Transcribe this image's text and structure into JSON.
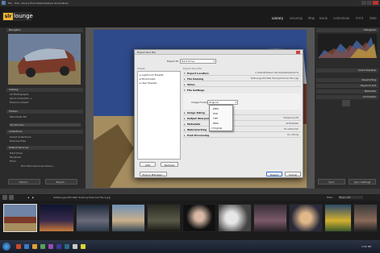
{
  "titlebar": {
    "menu": [
      "File",
      "Edit",
      "Library",
      "Photo",
      "Metadata",
      "View",
      "Window",
      "Help"
    ]
  },
  "brand": {
    "badge": "slr",
    "name": "lounge"
  },
  "modules": [
    "Library",
    "Develop",
    "Map",
    "Book",
    "Slideshow",
    "Print",
    "Web"
  ],
  "left_panel": {
    "navigator": "Navigator",
    "catalog": "Catalog",
    "catalog_items": [
      "All Photographs",
      "Quick Collection +",
      "Previous Import"
    ],
    "folders": "Folders",
    "folder_items": [
      "Macintosh HD",
      "My Pictures"
    ],
    "collections": "Collections",
    "collection_items": [
      "Smart Collections",
      "Exercise Files",
      "Lightroom Book",
      "Saved Quick Collection"
    ],
    "publish": "Publish Services",
    "publish_items": [
      "Hard Drive",
      "Facebook",
      "Flickr"
    ],
    "find_more": "Find More Services Online...",
    "import_btn": "Import...",
    "export_btn": "Export..."
  },
  "right_panel": {
    "histogram": "Histogram",
    "quick_develop": "Quick Develop",
    "keywording": "Keywording",
    "keyword_list": "Keyword List",
    "metadata": "Metadata",
    "comments": "Comments",
    "sync_btn": "Sync",
    "sync_settings_btn": "Sync Settings"
  },
  "dialog": {
    "title": "Export One File",
    "export_to_label": "Export To:",
    "export_to_value": "Hard Drive",
    "preset_header": "Preset:",
    "settings_header": "Export One File",
    "presets": [
      "Lightroom Presets",
      "Photomatix",
      "User Presets"
    ],
    "sections": [
      {
        "label": "Export Location",
        "value": "C:\\Users\\Professor Dennis\\Desktop\\Exports"
      },
      {
        "label": "File Naming",
        "value": "SLRlounge-004 Web Training Exercise File 2.jpg"
      },
      {
        "label": "Video",
        "value": ""
      },
      {
        "label": "File Settings",
        "value": ""
      }
    ],
    "image_format_label": "Image Format:",
    "image_format_value": "Original",
    "format_options": [
      "JPEG",
      "PSD",
      "TIFF",
      "DNG",
      "Original"
    ],
    "selected_format": "Original",
    "lower_sections": [
      {
        "label": "Image Sizing",
        "value": ""
      },
      {
        "label": "Output Sharpening",
        "value": "Sharpening Off"
      },
      {
        "label": "Metadata",
        "value": "All Metadata"
      },
      {
        "label": "Watermarking",
        "value": "No watermark"
      },
      {
        "label": "Post-Processing",
        "value": "Do nothing"
      }
    ],
    "add_btn": "Add",
    "remove_btn": "Remove",
    "plugin_btn": "Plug-in Manager...",
    "export_btn": "Export",
    "cancel_btn": "Cancel"
  },
  "filmstrip": {
    "path_label": "SLRlounge-004 Web Training Exercise File 2.jpg",
    "filter_label": "Filter :",
    "filter_value": "Filters Off"
  },
  "taskbar": {
    "time": "3:42 PM"
  },
  "colors": {
    "accent": "#f2b632",
    "brand_bg": "#2a2a2a",
    "dialog_bg": "#e9e9e9",
    "menu_highlight": "#2f6ec7"
  }
}
